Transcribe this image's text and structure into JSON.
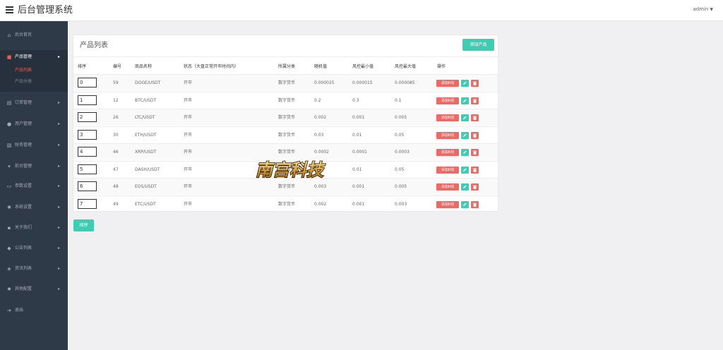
{
  "app": {
    "title": "后台管理系统",
    "user": "admin"
  },
  "sidebar": {
    "items": [
      {
        "label": "后台首页",
        "icon": "dashboard-icon"
      },
      {
        "label": "产品管理",
        "icon": "product-icon"
      },
      {
        "label": "订单管理",
        "icon": "order-icon"
      },
      {
        "label": "用户管理",
        "icon": "user-icon"
      },
      {
        "label": "财务管理",
        "icon": "finance-icon"
      },
      {
        "label": "前台管理",
        "icon": "frontend-icon"
      },
      {
        "label": "参数设置",
        "icon": "document-icon"
      },
      {
        "label": "系统设置",
        "icon": "gears-icon"
      },
      {
        "label": "关于我们",
        "icon": "about-icon"
      },
      {
        "label": "公告列表",
        "icon": "announcement-icon"
      },
      {
        "label": "资讯列表",
        "icon": "news-icon"
      },
      {
        "label": "其他配置",
        "icon": "config-icon"
      },
      {
        "label": "退出",
        "icon": "logout-icon"
      }
    ],
    "sub_items": [
      "产品列表",
      "产品分类"
    ]
  },
  "panel": {
    "title": "产品列表",
    "add_label": "添加产品",
    "sort_label": "排序"
  },
  "table": {
    "headers": [
      "排序",
      "编号",
      "商品名称",
      "状态（大盘正常开市时间内）",
      "所属分类",
      "随机值",
      "风控最小值",
      "风控最大值",
      "操作"
    ],
    "action_label": "添加K线",
    "rows": [
      {
        "sort": "0",
        "id": "59",
        "name": "DOGE/USDT",
        "status": "开市",
        "category": "数字货币",
        "random": "0.000025",
        "min": "0.000015",
        "max": "0.000085"
      },
      {
        "sort": "1",
        "id": "12",
        "name": "BTC/USDT",
        "status": "开市",
        "category": "数字货币",
        "random": "0.2",
        "min": "0.3",
        "max": "0.1"
      },
      {
        "sort": "2",
        "id": "26",
        "name": "LTC/USDT",
        "status": "开市",
        "category": "数字货币",
        "random": "0.002",
        "min": "0.001",
        "max": "0.005"
      },
      {
        "sort": "3",
        "id": "30",
        "name": "ETH/USDT",
        "status": "开市",
        "category": "数字货币",
        "random": "0.03",
        "min": "0.01",
        "max": "0.05"
      },
      {
        "sort": "4",
        "id": "46",
        "name": "XRP/USDT",
        "status": "开市",
        "category": "数字货币",
        "random": "0.0002",
        "min": "0.0001",
        "max": "0.0003"
      },
      {
        "sort": "5",
        "id": "47",
        "name": "DASH/USDT",
        "status": "开市",
        "category": "数字货币",
        "random": "0.03",
        "min": "0.01",
        "max": "0.05"
      },
      {
        "sort": "6",
        "id": "48",
        "name": "EOS/USDT",
        "status": "开市",
        "category": "数字货币",
        "random": "0.003",
        "min": "0.001",
        "max": "0.005"
      },
      {
        "sort": "7",
        "id": "49",
        "name": "ETC/USDT",
        "status": "开市",
        "category": "数字货币",
        "random": "0.002",
        "min": "0.001",
        "max": "0.003"
      }
    ]
  },
  "watermark": {
    "text": "南宫科技"
  },
  "colors": {
    "accent": "#3dcdb2",
    "danger": "#ec6a65",
    "sidebar": "#2f3a49",
    "active": "#ee5b4f"
  }
}
